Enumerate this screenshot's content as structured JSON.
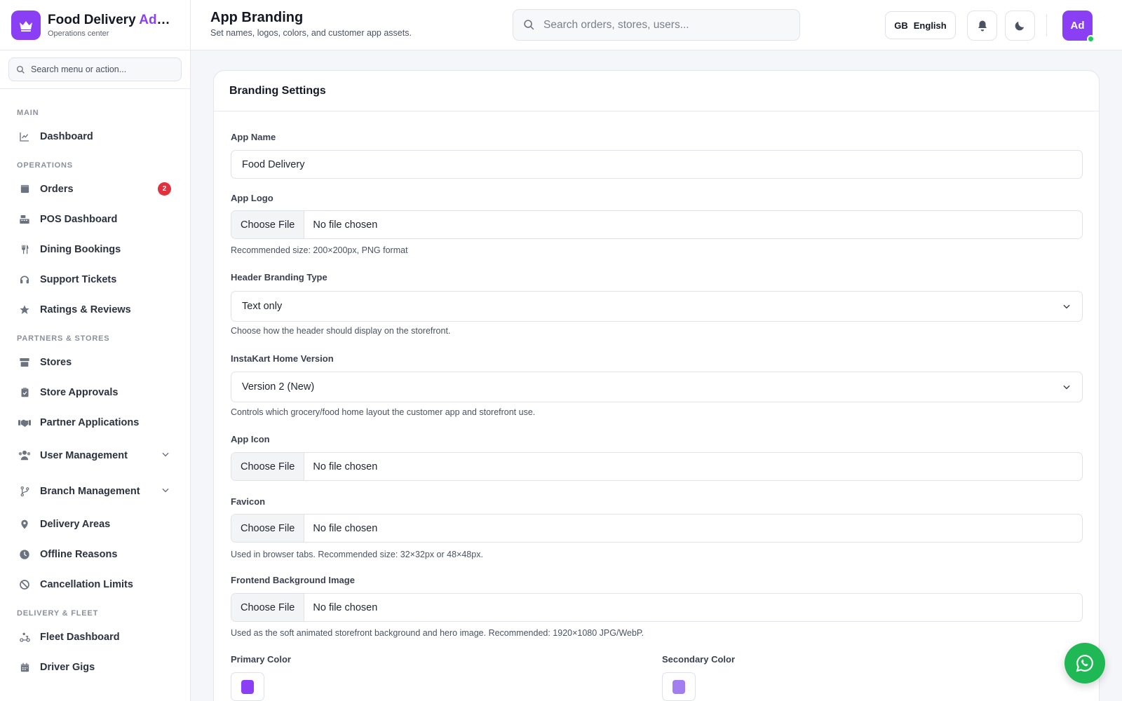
{
  "brand": {
    "title_main": "Food Delivery ",
    "title_accent": "Admin",
    "subtitle": "Operations center"
  },
  "sidebar": {
    "search_placeholder": "Search menu or action...",
    "sections": {
      "main": "MAIN",
      "operations": "OPERATIONS",
      "partners": "PARTNERS & STORES",
      "fleet": "DELIVERY & FLEET"
    },
    "items": {
      "dashboard": "Dashboard",
      "orders": "Orders",
      "orders_badge": "2",
      "pos": "POS Dashboard",
      "dining": "Dining Bookings",
      "support": "Support Tickets",
      "ratings": "Ratings & Reviews",
      "stores": "Stores",
      "store_approvals": "Store Approvals",
      "partner_apps": "Partner Applications",
      "user_mgmt": "User Management",
      "branch_mgmt": "Branch Management",
      "delivery_areas": "Delivery Areas",
      "offline_reasons": "Offline Reasons",
      "cancellation": "Cancellation Limits",
      "fleet_dashboard": "Fleet Dashboard",
      "driver_gigs": "Driver Gigs"
    }
  },
  "header": {
    "title": "App Branding",
    "subtitle": "Set names, logos, colors, and customer app assets.",
    "search_placeholder": "Search orders, stores, users...",
    "lang_flag": "GB",
    "lang_label": "English",
    "avatar_initials": "Ad"
  },
  "card": {
    "title": "Branding Settings"
  },
  "form": {
    "app_name_label": "App Name",
    "app_name_value": "Food Delivery",
    "app_logo_label": "App Logo",
    "choose_file": "Choose File",
    "no_file": "No file chosen",
    "app_logo_help": "Recommended size: 200×200px, PNG format",
    "header_type_label": "Header Branding Type",
    "header_type_value": "Text only",
    "header_type_help": "Choose how the header should display on the storefront.",
    "home_version_label": "InstaKart Home Version",
    "home_version_value": "Version 2 (New)",
    "home_version_help": "Controls which grocery/food home layout the customer app and storefront use.",
    "app_icon_label": "App Icon",
    "favicon_label": "Favicon",
    "favicon_help": "Used in browser tabs. Recommended size: 32×32px or 48×48px.",
    "bg_image_label": "Frontend Background Image",
    "bg_image_help": "Used as the soft animated storefront background and hero image. Recommended: 1920×1080 JPG/WebP.",
    "primary_color_label": "Primary Color",
    "secondary_color_label": "Secondary Color"
  },
  "colors": {
    "primary": "#8b3ff5",
    "secondary": "#a37ef0",
    "badge": "#e0313d",
    "whatsapp": "#1fb855"
  }
}
